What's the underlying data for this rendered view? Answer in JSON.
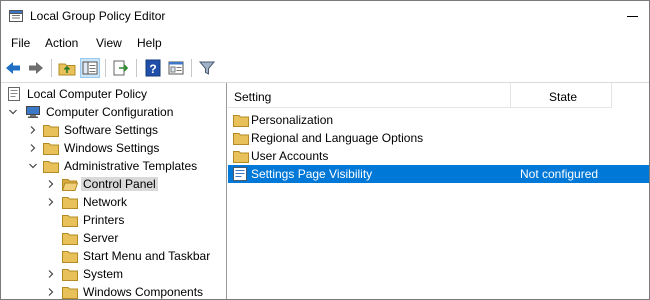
{
  "window": {
    "title": "Local Group Policy Editor",
    "icon": "policy-editor-icon"
  },
  "menu": [
    "File",
    "Action",
    "View",
    "Help"
  ],
  "toolbar": {
    "buttons": [
      "back-arrow-icon",
      "forward-arrow-icon",
      "up-folder-icon",
      "show-hide-tree-icon",
      "export-list-icon",
      "help-icon",
      "properties-icon",
      "filter-icon"
    ]
  },
  "tree": {
    "root": "Local Computer Policy",
    "computer_configuration": "Computer Configuration",
    "software_settings": "Software Settings",
    "windows_settings": "Windows Settings",
    "administrative_templates": "Administrative Templates",
    "control_panel": "Control Panel",
    "network": "Network",
    "printers": "Printers",
    "server": "Server",
    "start_menu": "Start Menu and Taskbar",
    "system": "System",
    "windows_components": "Windows Components"
  },
  "list": {
    "headers": {
      "setting": "Setting",
      "state": "State"
    },
    "rows": [
      {
        "name": "Personalization",
        "state": "",
        "icon": "folder-icon"
      },
      {
        "name": "Regional and Language Options",
        "state": "",
        "icon": "folder-icon"
      },
      {
        "name": "User Accounts",
        "state": "",
        "icon": "folder-icon"
      },
      {
        "name": "Settings Page Visibility",
        "state": "Not configured",
        "icon": "setting-icon",
        "selected": true
      }
    ]
  },
  "colors": {
    "selection": "#0078d7",
    "tree_selection": "#d9d9d9",
    "folder": "#e8c15a"
  }
}
